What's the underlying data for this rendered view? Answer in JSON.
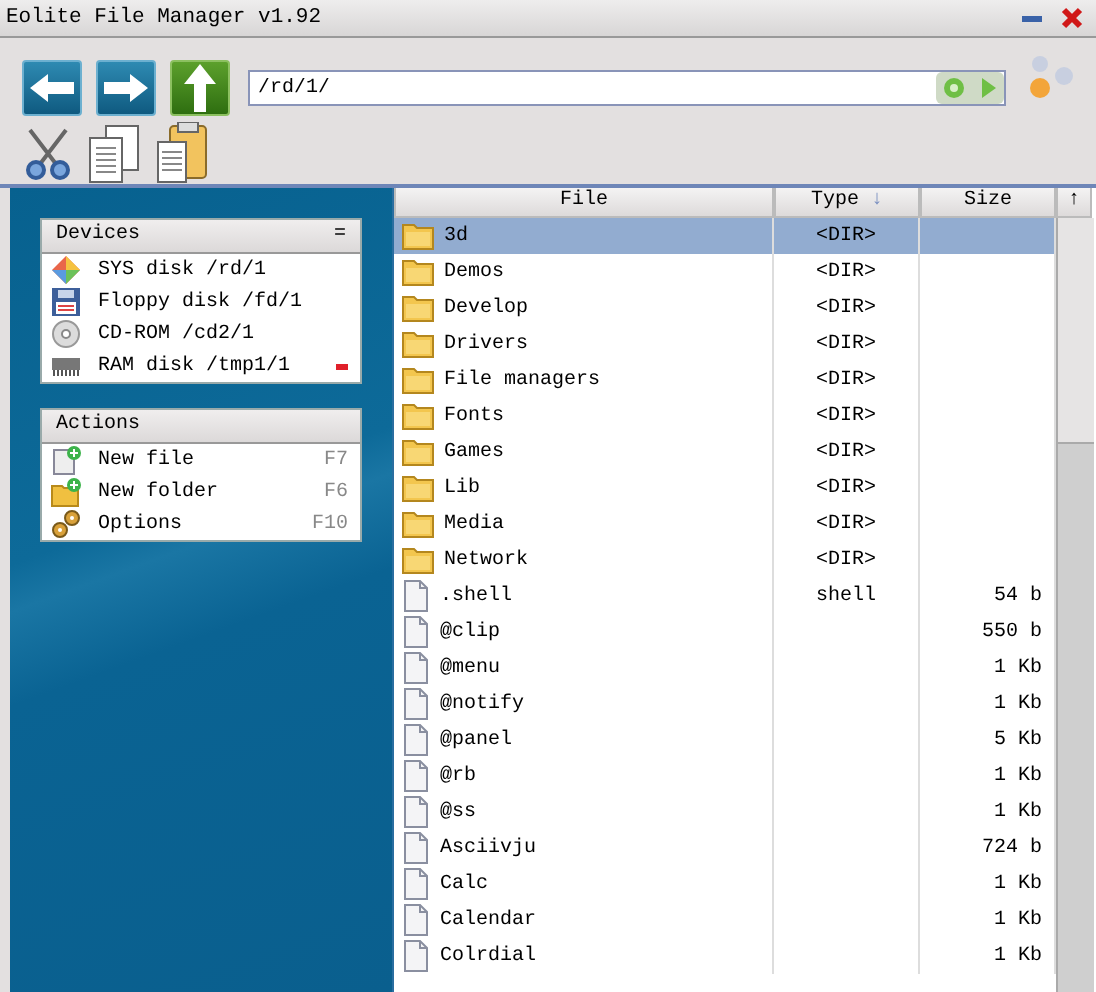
{
  "window": {
    "title": "Eolite File Manager v1.92"
  },
  "address": {
    "value": "/rd/1/"
  },
  "devices": {
    "title": "Devices",
    "menu_glyph": "=",
    "items": [
      {
        "label": "SYS disk /rd/1",
        "kind": "sys",
        "ejectable": false
      },
      {
        "label": "Floppy disk /fd/1",
        "kind": "floppy",
        "ejectable": false
      },
      {
        "label": "CD-ROM /cd2/1",
        "kind": "cd",
        "ejectable": false
      },
      {
        "label": "RAM disk /tmp1/1",
        "kind": "ram",
        "ejectable": true
      }
    ]
  },
  "actions": {
    "title": "Actions",
    "items": [
      {
        "label": "New file",
        "shortcut": "F7",
        "kind": "newfile"
      },
      {
        "label": "New folder",
        "shortcut": "F6",
        "kind": "newfolder"
      },
      {
        "label": "Options",
        "shortcut": "F10",
        "kind": "options"
      }
    ]
  },
  "table": {
    "columns": [
      {
        "label": "File"
      },
      {
        "label": "Type",
        "sort": "↓"
      },
      {
        "label": "Size"
      }
    ],
    "scroll_up": "↑",
    "rows": [
      {
        "name": "3d",
        "type": "<DIR>",
        "size": "",
        "kind": "folder",
        "selected": true
      },
      {
        "name": "Demos",
        "type": "<DIR>",
        "size": "",
        "kind": "folder",
        "selected": false
      },
      {
        "name": "Develop",
        "type": "<DIR>",
        "size": "",
        "kind": "folder",
        "selected": false
      },
      {
        "name": "Drivers",
        "type": "<DIR>",
        "size": "",
        "kind": "folder",
        "selected": false
      },
      {
        "name": "File managers",
        "type": "<DIR>",
        "size": "",
        "kind": "folder",
        "selected": false
      },
      {
        "name": "Fonts",
        "type": "<DIR>",
        "size": "",
        "kind": "folder",
        "selected": false
      },
      {
        "name": "Games",
        "type": "<DIR>",
        "size": "",
        "kind": "folder",
        "selected": false
      },
      {
        "name": "Lib",
        "type": "<DIR>",
        "size": "",
        "kind": "folder",
        "selected": false
      },
      {
        "name": "Media",
        "type": "<DIR>",
        "size": "",
        "kind": "folder",
        "selected": false
      },
      {
        "name": "Network",
        "type": "<DIR>",
        "size": "",
        "kind": "folder",
        "selected": false
      },
      {
        "name": ".shell",
        "type": "shell",
        "size": "54 b",
        "kind": "file",
        "selected": false
      },
      {
        "name": "@clip",
        "type": "",
        "size": "550 b",
        "kind": "file",
        "selected": false
      },
      {
        "name": "@menu",
        "type": "",
        "size": "1 Kb",
        "kind": "file",
        "selected": false
      },
      {
        "name": "@notify",
        "type": "",
        "size": "1 Kb",
        "kind": "file",
        "selected": false
      },
      {
        "name": "@panel",
        "type": "",
        "size": "5 Kb",
        "kind": "file",
        "selected": false
      },
      {
        "name": "@rb",
        "type": "",
        "size": "1 Kb",
        "kind": "file",
        "selected": false
      },
      {
        "name": "@ss",
        "type": "",
        "size": "1 Kb",
        "kind": "file",
        "selected": false
      },
      {
        "name": "Asciivju",
        "type": "",
        "size": "724 b",
        "kind": "file",
        "selected": false
      },
      {
        "name": "Calc",
        "type": "",
        "size": "1 Kb",
        "kind": "file",
        "selected": false
      },
      {
        "name": "Calendar",
        "type": "",
        "size": "1 Kb",
        "kind": "file",
        "selected": false
      },
      {
        "name": "Colrdial",
        "type": "",
        "size": "1 Kb",
        "kind": "file",
        "selected": false
      }
    ]
  }
}
